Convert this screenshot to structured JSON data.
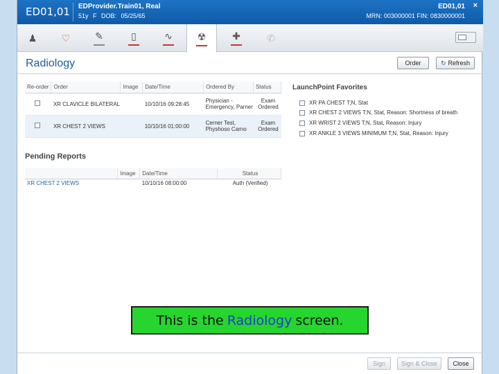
{
  "banner": {
    "location": "ED01,01",
    "patient_name": "EDProvider.Train01, Real",
    "demographics": "51y  F  DOB: 05/25/65",
    "location_right": "ED01,01",
    "ids": "MRN: 003000001  FIN: 0830000001",
    "close_glyph": "×"
  },
  "toolbar": {
    "buttons": [
      {
        "name": "stamp",
        "glyph": "♟"
      },
      {
        "name": "heart",
        "glyph": "♡"
      },
      {
        "name": "syringe",
        "glyph": "✎"
      },
      {
        "name": "test-tube",
        "glyph": "▯"
      },
      {
        "name": "vitals",
        "glyph": "∿"
      },
      {
        "name": "radiology",
        "glyph": "☢"
      },
      {
        "name": "medkit",
        "glyph": "✚"
      },
      {
        "name": "phone",
        "glyph": "✆"
      }
    ],
    "accent_color": "#c0392b"
  },
  "page": {
    "title": "Radiology",
    "order_button": "Order",
    "refresh_button": "Refresh",
    "refresh_icon": "↻"
  },
  "orders": {
    "headers": [
      "Re-order",
      "Order",
      "Image",
      "Date/Time",
      "Ordered By",
      "Status"
    ],
    "rows": [
      {
        "order": "XR CLAVICLE BILATERAL",
        "image": "",
        "datetime": "10/10/16 09:28:45",
        "ordered_by": "Physician - Emergency, Parner",
        "status": "Exam Ordered"
      },
      {
        "order": "XR CHEST 2 VIEWS",
        "image": "",
        "datetime": "10/10/16 01:00:00",
        "ordered_by": "Cerner Test, Physhoso Carno",
        "status": "Exam Ordered"
      }
    ]
  },
  "launchpoint": {
    "title": "LaunchPoint Favorites",
    "items": [
      "XR PA CHEST T;N, Stat",
      "XR CHEST 2 VIEWS T;N, Stat, Reason: Shortness of breath",
      "XR WRIST 2 VIEWS T;N, Stat, Reason: Injury",
      "XR ANKLE 3 VIEWS MINIMUM T;N, Stat, Reason: Injury"
    ]
  },
  "pending": {
    "title": "Pending Reports",
    "headers": [
      "",
      "Image",
      "Date/Time",
      "Status"
    ],
    "rows": [
      {
        "name": "XR CHEST 2 VIEWS",
        "image": "",
        "datetime": "10/10/16 08:00:00",
        "status": "Auth (Verified)"
      }
    ]
  },
  "caption": {
    "before": "This is the",
    "highlight": "Radiology",
    "after": "screen."
  },
  "footer": {
    "sign": "Sign",
    "sign_close": "Sign & Close",
    "close": "Close"
  }
}
